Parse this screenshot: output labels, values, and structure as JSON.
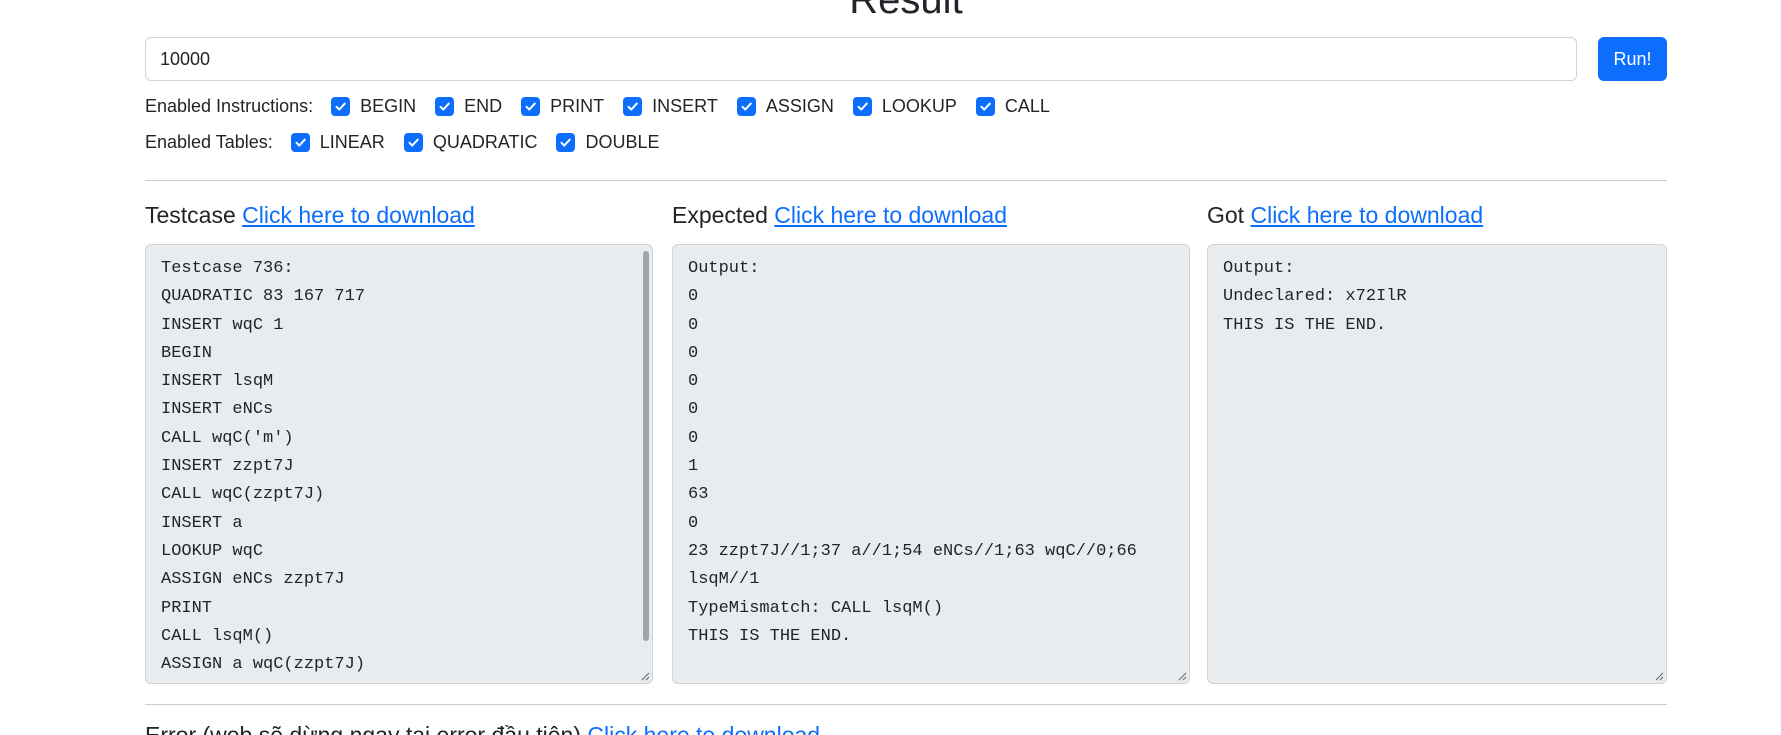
{
  "page": {
    "title": "Result"
  },
  "run": {
    "seed_value": "10000",
    "button_label": "Run!"
  },
  "instructions": {
    "label": "Enabled Instructions:",
    "options": [
      {
        "label": "BEGIN",
        "checked": true
      },
      {
        "label": "END",
        "checked": true
      },
      {
        "label": "PRINT",
        "checked": true
      },
      {
        "label": "INSERT",
        "checked": true
      },
      {
        "label": "ASSIGN",
        "checked": true
      },
      {
        "label": "LOOKUP",
        "checked": true
      },
      {
        "label": "CALL",
        "checked": true
      }
    ]
  },
  "tables": {
    "label": "Enabled Tables:",
    "options": [
      {
        "label": "LINEAR",
        "checked": true
      },
      {
        "label": "QUADRATIC",
        "checked": true
      },
      {
        "label": "DOUBLE",
        "checked": true
      }
    ]
  },
  "panels": {
    "testcase": {
      "title": "Testcase",
      "link": "Click here to download",
      "lines": [
        "Testcase 736:",
        "QUADRATIC 83 167 717",
        "INSERT wqC 1",
        "BEGIN",
        "INSERT lsqM",
        "INSERT eNCs",
        "CALL wqC('m')",
        "INSERT zzpt7J",
        "CALL wqC(zzpt7J)",
        "INSERT a",
        "LOOKUP wqC",
        "ASSIGN eNCs zzpt7J",
        "PRINT",
        "CALL lsqM()",
        "ASSIGN a wqC(zzpt7J)"
      ]
    },
    "expected": {
      "title": "Expected",
      "link": "Click here to download",
      "lines": [
        "Output:",
        "0",
        "0",
        "0",
        "0",
        "0",
        "0",
        "1",
        "63",
        "0",
        "23 zzpt7J//1;37 a//1;54 eNCs//1;63 wqC//0;66",
        "lsqM//1",
        "TypeMismatch: CALL lsqM()",
        "THIS IS THE END."
      ]
    },
    "got": {
      "title": "Got",
      "link": "Click here to download",
      "lines": [
        "Output:",
        "Undeclared: x72IlR",
        "THIS IS THE END."
      ]
    }
  },
  "error_section": {
    "title": "Error (web sẽ dừng ngay tại error đầu tiên)",
    "link": "Click here to download"
  },
  "colors": {
    "accent": "#0d6efd",
    "code_background": "#e9ecef"
  }
}
